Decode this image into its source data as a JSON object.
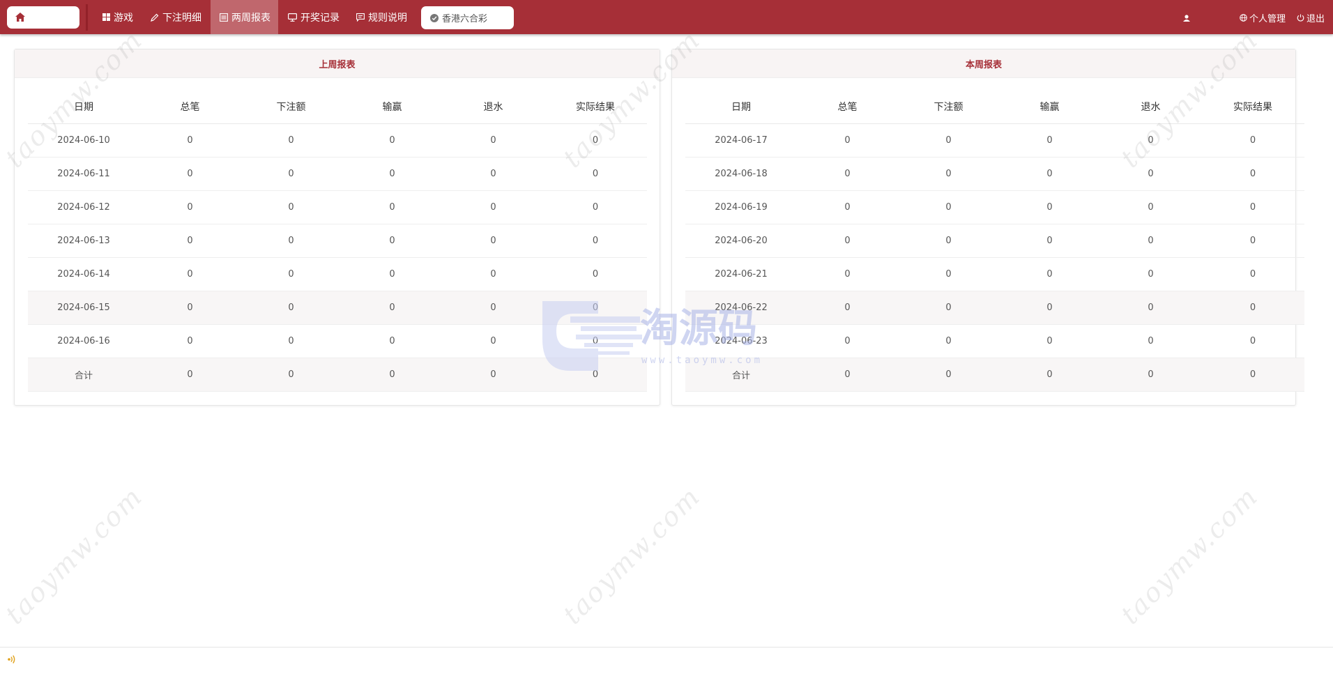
{
  "nav": {
    "items": [
      {
        "label": "游戏",
        "icon": "grid-icon"
      },
      {
        "label": "下注明细",
        "icon": "pencil-icon"
      },
      {
        "label": "两周报表",
        "icon": "list-icon"
      },
      {
        "label": "开奖记录",
        "icon": "monitor-icon"
      },
      {
        "label": "规则说明",
        "icon": "comment-icon"
      }
    ],
    "active": "两周报表",
    "lottery": "香港六合彩",
    "personal": "个人管理",
    "logout": "退出"
  },
  "colors": {
    "brand": "#a62f37",
    "active_tab": "#c0676d",
    "panel_title": "#a62f37"
  },
  "last_week": {
    "title": "上周报表",
    "headers": [
      "日期",
      "总笔",
      "下注额",
      "输赢",
      "退水",
      "实际结果"
    ],
    "rows": [
      [
        "2024-06-10",
        "0",
        "0",
        "0",
        "0",
        "0"
      ],
      [
        "2024-06-11",
        "0",
        "0",
        "0",
        "0",
        "0"
      ],
      [
        "2024-06-12",
        "0",
        "0",
        "0",
        "0",
        "0"
      ],
      [
        "2024-06-13",
        "0",
        "0",
        "0",
        "0",
        "0"
      ],
      [
        "2024-06-14",
        "0",
        "0",
        "0",
        "0",
        "0"
      ],
      [
        "2024-06-15",
        "0",
        "0",
        "0",
        "0",
        "0"
      ],
      [
        "2024-06-16",
        "0",
        "0",
        "0",
        "0",
        "0"
      ]
    ],
    "total": [
      "合计",
      "0",
      "0",
      "0",
      "0",
      "0"
    ]
  },
  "this_week": {
    "title": "本周报表",
    "headers": [
      "日期",
      "总笔",
      "下注额",
      "输赢",
      "退水",
      "实际结果"
    ],
    "rows": [
      [
        "2024-06-17",
        "0",
        "0",
        "0",
        "0",
        "0"
      ],
      [
        "2024-06-18",
        "0",
        "0",
        "0",
        "0",
        "0"
      ],
      [
        "2024-06-19",
        "0",
        "0",
        "0",
        "0",
        "0"
      ],
      [
        "2024-06-20",
        "0",
        "0",
        "0",
        "0",
        "0"
      ],
      [
        "2024-06-21",
        "0",
        "0",
        "0",
        "0",
        "0"
      ],
      [
        "2024-06-22",
        "0",
        "0",
        "0",
        "0",
        "0"
      ],
      [
        "2024-06-23",
        "0",
        "0",
        "0",
        "0",
        "0"
      ]
    ],
    "total": [
      "合计",
      "0",
      "0",
      "0",
      "0",
      "0"
    ]
  },
  "watermark": "taoymw.com",
  "logo": {
    "text": "淘源码",
    "url": "www.taoymw.com"
  }
}
